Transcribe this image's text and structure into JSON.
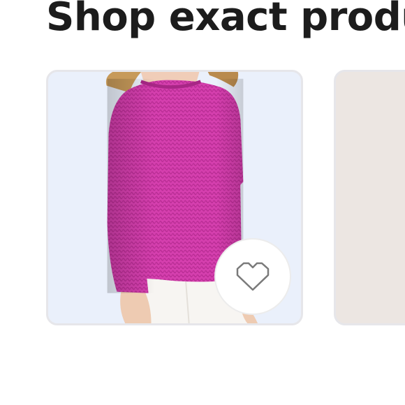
{
  "section": {
    "title": "Shop exact produ"
  },
  "products": [
    {
      "image_desc": "pink-knit-sweater",
      "favorite_icon": "heart-outline-icon"
    },
    {
      "image_desc": "product-image-partial"
    }
  ],
  "colors": {
    "card1_bg": "#eaf0fb",
    "card2_bg": "#ece6e2",
    "sweater": "#d63fae",
    "title": "#1c1c1c"
  }
}
